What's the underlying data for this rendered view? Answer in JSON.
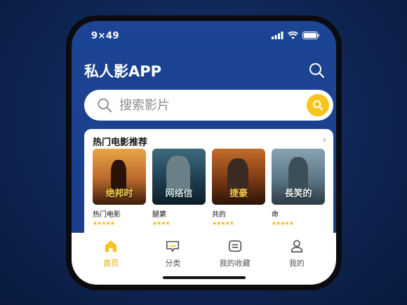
{
  "status_bar": {
    "time": "9×49"
  },
  "header": {
    "title": "私人影APP",
    "search_icon": "search-icon"
  },
  "search": {
    "placeholder": "搜索影片",
    "button_icon": "search-icon"
  },
  "section": {
    "title": "热门电影推荐",
    "more_icon": "chevron-right-icon",
    "movies": [
      {
        "poster_text": "绝邦时",
        "name": "热门电影",
        "rating": "★★★★★",
        "rating_value": 5
      },
      {
        "poster_text": "网络信",
        "name": "腿綮",
        "rating": "★★★★",
        "rating_value": 4
      },
      {
        "poster_text": "捷豪",
        "name": "共的",
        "rating": "★★★★★",
        "rating_value": 5
      },
      {
        "poster_text": "長笑的",
        "name": "命",
        "rating": "★★★★★",
        "rating_value": 5
      }
    ]
  },
  "tabs": [
    {
      "label": "首页",
      "icon": "home-icon",
      "active": true
    },
    {
      "label": "分类",
      "icon": "category-icon",
      "active": false
    },
    {
      "label": "我的收藏",
      "icon": "favorites-icon",
      "active": false
    },
    {
      "label": "我的",
      "icon": "profile-icon",
      "active": false
    }
  ],
  "colors": {
    "accent": "#f7c51d",
    "header_bg": "#1d4595",
    "active_tab": "#e8a800"
  }
}
